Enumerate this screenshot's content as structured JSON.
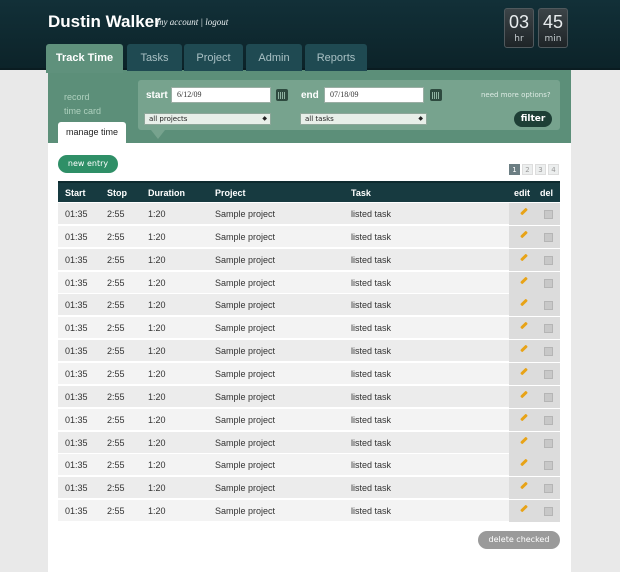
{
  "header": {
    "user_name": "Dustin Walker",
    "account_links": "my account | logout",
    "clock": {
      "hours": "03",
      "hours_unit": "hr",
      "minutes": "45",
      "minutes_unit": "min"
    }
  },
  "tabs": [
    {
      "label": "Track Time",
      "active": true
    },
    {
      "label": "Tasks",
      "active": false
    },
    {
      "label": "Project",
      "active": false
    },
    {
      "label": "Admin",
      "active": false
    },
    {
      "label": "Reports",
      "active": false
    }
  ],
  "side_nav": {
    "record": "record",
    "time_card": "time card",
    "manage_time": "manage time"
  },
  "filter": {
    "start_label": "start",
    "start_value": "6/12/09",
    "end_label": "end",
    "end_value": "07/18/09",
    "project_select": "all projects",
    "task_select": "all tasks",
    "more_options": "need more options?",
    "filter_button": "filter"
  },
  "new_entry_button": "new entry",
  "pagination": [
    "1",
    "2",
    "3",
    "4"
  ],
  "table": {
    "headers": {
      "start": "Start",
      "stop": "Stop",
      "duration": "Duration",
      "project": "Project",
      "task": "Task",
      "edit": "edit",
      "del": "del"
    },
    "rows": [
      {
        "start": "01:35",
        "stop": "2:55",
        "duration": "1:20",
        "project": "Sample project",
        "task": "listed task"
      },
      {
        "start": "01:35",
        "stop": "2:55",
        "duration": "1:20",
        "project": "Sample project",
        "task": "listed task"
      },
      {
        "start": "01:35",
        "stop": "2:55",
        "duration": "1:20",
        "project": "Sample project",
        "task": "listed task"
      },
      {
        "start": "01:35",
        "stop": "2:55",
        "duration": "1:20",
        "project": "Sample project",
        "task": "listed task"
      },
      {
        "start": "01:35",
        "stop": "2:55",
        "duration": "1:20",
        "project": "Sample project",
        "task": "listed task"
      },
      {
        "start": "01:35",
        "stop": "2:55",
        "duration": "1:20",
        "project": "Sample project",
        "task": "listed task"
      },
      {
        "start": "01:35",
        "stop": "2:55",
        "duration": "1:20",
        "project": "Sample project",
        "task": "listed task"
      },
      {
        "start": "01:35",
        "stop": "2:55",
        "duration": "1:20",
        "project": "Sample project",
        "task": "listed task"
      },
      {
        "start": "01:35",
        "stop": "2:55",
        "duration": "1:20",
        "project": "Sample project",
        "task": "listed task"
      },
      {
        "start": "01:35",
        "stop": "2:55",
        "duration": "1:20",
        "project": "Sample project",
        "task": "listed task"
      },
      {
        "start": "01:35",
        "stop": "2:55",
        "duration": "1:20",
        "project": "Sample project",
        "task": "listed task"
      },
      {
        "start": "01:35",
        "stop": "2:55",
        "duration": "1:20",
        "project": "Sample project",
        "task": "listed task"
      },
      {
        "start": "01:35",
        "stop": "2:55",
        "duration": "1:20",
        "project": "Sample project",
        "task": "listed task"
      },
      {
        "start": "01:35",
        "stop": "2:55",
        "duration": "1:20",
        "project": "Sample project",
        "task": "listed task"
      }
    ]
  },
  "delete_checked_button": "delete checked",
  "colors": {
    "header": "#123038",
    "accent_green": "#5c8f79",
    "button_green": "#2f8f67",
    "pencil": "#e8a317"
  }
}
